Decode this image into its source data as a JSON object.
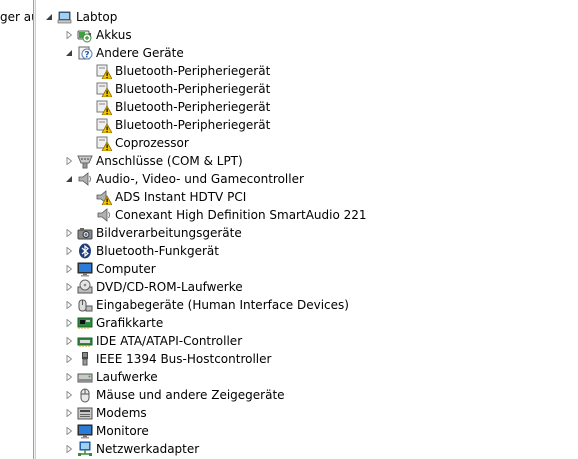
{
  "left_pane": {
    "label": "ger au"
  },
  "tree": {
    "root": {
      "label": "Labtop",
      "expanded": true,
      "icon": "computer-icon"
    },
    "categories": [
      {
        "label": "Akkus",
        "expanded": false,
        "icon": "battery-icon"
      },
      {
        "label": "Andere Geräte",
        "expanded": true,
        "icon": "unknown-device-icon",
        "children": [
          {
            "label": "Bluetooth-Peripheriegerät",
            "icon": "warning-device-icon"
          },
          {
            "label": "Bluetooth-Peripheriegerät",
            "icon": "warning-device-icon"
          },
          {
            "label": "Bluetooth-Peripheriegerät",
            "icon": "warning-device-icon"
          },
          {
            "label": "Bluetooth-Peripheriegerät",
            "icon": "warning-device-icon"
          },
          {
            "label": "Coprozessor",
            "icon": "warning-device-icon"
          }
        ]
      },
      {
        "label": "Anschlüsse (COM & LPT)",
        "expanded": false,
        "icon": "port-icon"
      },
      {
        "label": "Audio-, Video- und Gamecontroller",
        "expanded": true,
        "icon": "speaker-icon",
        "children": [
          {
            "label": "ADS Instant HDTV PCI",
            "icon": "warning-speaker-icon"
          },
          {
            "label": "Conexant High Definition SmartAudio 221",
            "icon": "speaker-icon"
          }
        ]
      },
      {
        "label": "Bildverarbeitungsgeräte",
        "expanded": false,
        "icon": "camera-icon"
      },
      {
        "label": "Bluetooth-Funkgerät",
        "expanded": false,
        "icon": "bluetooth-icon"
      },
      {
        "label": "Computer",
        "expanded": false,
        "icon": "monitor-icon"
      },
      {
        "label": "DVD/CD-ROM-Laufwerke",
        "expanded": false,
        "icon": "disc-drive-icon"
      },
      {
        "label": "Eingabegeräte (Human Interface Devices)",
        "expanded": false,
        "icon": "hid-icon"
      },
      {
        "label": "Grafikkarte",
        "expanded": false,
        "icon": "display-adapter-icon"
      },
      {
        "label": "IDE ATA/ATAPI-Controller",
        "expanded": false,
        "icon": "ide-controller-icon"
      },
      {
        "label": "IEEE 1394 Bus-Hostcontroller",
        "expanded": false,
        "icon": "firewire-icon"
      },
      {
        "label": "Laufwerke",
        "expanded": false,
        "icon": "drive-icon"
      },
      {
        "label": "Mäuse und andere Zeigegeräte",
        "expanded": false,
        "icon": "mouse-icon"
      },
      {
        "label": "Modems",
        "expanded": false,
        "icon": "modem-icon"
      },
      {
        "label": "Monitore",
        "expanded": false,
        "icon": "monitor-icon"
      },
      {
        "label": "Netzwerkadapter",
        "expanded": false,
        "icon": "network-adapter-icon"
      }
    ]
  },
  "colors": {
    "warning": "#f2c200",
    "selection": "#cce8ff",
    "tree_line": "#a0a0a0"
  }
}
